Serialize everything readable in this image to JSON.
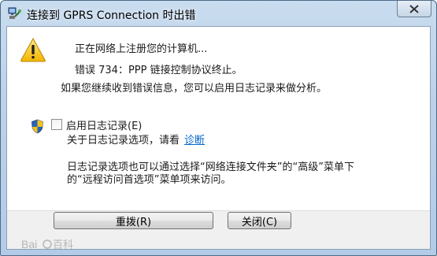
{
  "window": {
    "title": "连接到 GPRS Connection 时出错",
    "title_icon": "network-connection-icon",
    "close_icon": "close-icon"
  },
  "message": {
    "icon": "warning-icon",
    "line1": "正在网络上注册您的计算机...",
    "line2": "错误 734：PPP 链接控制协议终止。",
    "line3": "如果您继续收到错误信息，您可以启用日志记录来做分析。"
  },
  "logging": {
    "shield_icon": "uac-shield-icon",
    "checkbox_label": "启用日志记录(E)",
    "checked": false,
    "about_text": "关于日志记录选项，请看",
    "diagnostics_link": "诊断",
    "note_line1": "日志记录选项也可以通过选择“网络连接文件夹”的“高级”菜单下",
    "note_line2": "的“远程访问首选项”菜单项来访问。"
  },
  "buttons": {
    "redial": "重拨(R)",
    "close": "关闭(C)"
  },
  "watermark": {
    "text": "Bai 百科"
  }
}
